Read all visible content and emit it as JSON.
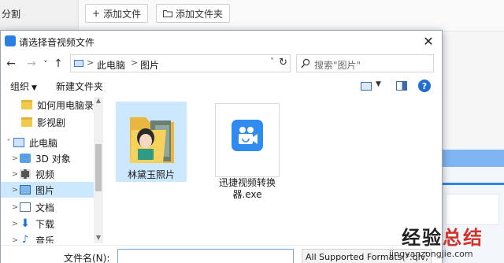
{
  "background_app": {
    "left_label": "分割",
    "add_file_label": "添加文件",
    "add_folder_label": "添加文件夹"
  },
  "dialog": {
    "title": "请选择音视频文件",
    "close_glyph": "✕",
    "nav": {
      "back_glyph": "←",
      "forward_glyph": "→",
      "recent_glyph": "˅",
      "up_glyph": "↑",
      "address_segments": [
        "此电脑",
        "图片"
      ],
      "separator_glyph": ">",
      "dropdown_glyph": "˅",
      "refresh_glyph": "↻",
      "search_placeholder": "搜索\"图片\""
    },
    "commands": {
      "organize_label": "组织",
      "organize_caret": "▼",
      "new_folder_label": "新建文件夹",
      "view_caret": "▼",
      "help_glyph": "?"
    },
    "tree": [
      {
        "label": "如何用电脑录音:",
        "icon": "folder-icon",
        "arrow": "",
        "selected": false
      },
      {
        "label": "影视剧",
        "icon": "folder-icon",
        "arrow": "",
        "selected": false
      },
      {
        "label": "此电脑",
        "icon": "computer-icon",
        "arrow": "˅",
        "selected": false
      },
      {
        "label": "3D 对象",
        "icon": "3d-objects-icon",
        "arrow": ">",
        "selected": false
      },
      {
        "label": "视频",
        "icon": "video-icon",
        "arrow": ">",
        "selected": false
      },
      {
        "label": "图片",
        "icon": "pictures-icon",
        "arrow": ">",
        "selected": true
      },
      {
        "label": "文档",
        "icon": "documents-icon",
        "arrow": ">",
        "selected": false
      },
      {
        "label": "下载",
        "icon": "downloads-icon",
        "arrow": ">",
        "selected": false
      },
      {
        "label": "音乐",
        "icon": "music-icon",
        "arrow": ">",
        "selected": false
      }
    ],
    "scroll": {
      "up_glyph": "▲",
      "down_glyph": "▼"
    },
    "files": [
      {
        "label": "林黛玉照片",
        "type": "folder",
        "selected": true
      },
      {
        "label": "迅捷视频转换器.exe",
        "type": "exe",
        "selected": false
      }
    ],
    "bottom": {
      "filename_label": "文件名(N):",
      "filename_value": "",
      "filter_value": "All Supported Formats(*.qlv;",
      "filter_caret": "˅"
    }
  },
  "watermark": {
    "big_text_part1": "经验",
    "big_text_part2": "总结",
    "small_text": "jingyanzongjie.com"
  },
  "colors": {
    "accent_blue": "#2b7fe0",
    "selection": "#cce8ff",
    "folder_yellow": "#f3c94a",
    "watermark_red": "#d3322c"
  }
}
